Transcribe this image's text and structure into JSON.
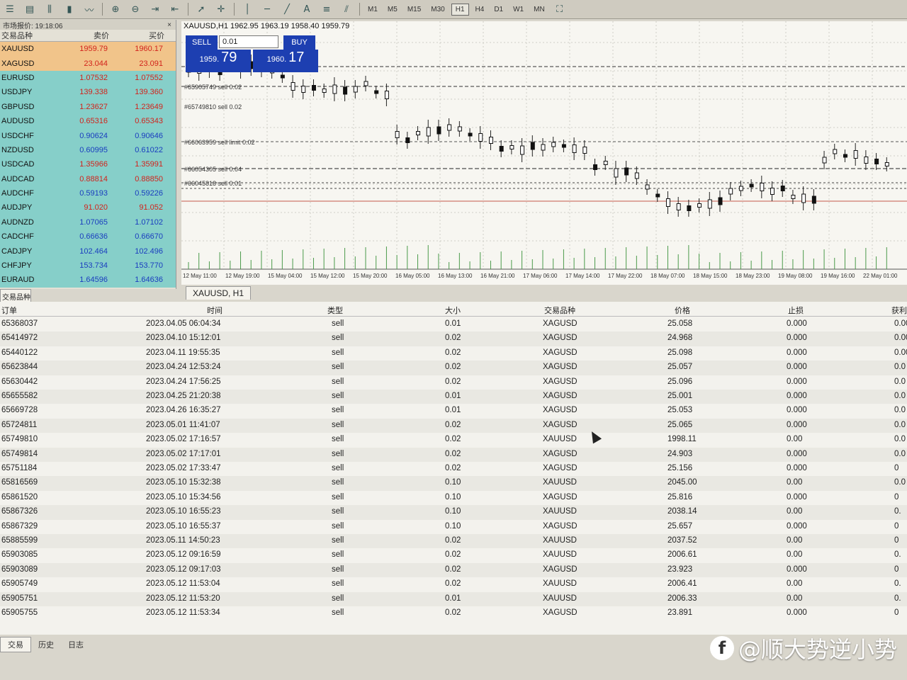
{
  "toolbar": {
    "icons": [
      "menu-icon",
      "profiles-icon",
      "chart-bars-icon",
      "candles-icon",
      "line-chart-icon",
      "zoom-in-icon",
      "zoom-out-icon",
      "autoscroll-icon",
      "chart-shift-icon",
      "cursor-icon",
      "crosshair-icon",
      "vertical-line-icon",
      "horizontal-line-icon",
      "trendline-icon",
      "text-icon",
      "fibonacci-icon",
      "channel-icon"
    ],
    "timeframes": [
      "M1",
      "M5",
      "M15",
      "M30",
      "H1",
      "H4",
      "D1",
      "W1",
      "MN"
    ],
    "active_timeframe": "H1"
  },
  "market_watch": {
    "title": "市场报价: 19:18:06",
    "close_label": "×",
    "col_symbol": "交易品种",
    "col_bid": "卖价",
    "col_ask": "买价",
    "rows": [
      {
        "symbol": "XAUUSD",
        "bid": "1959.79",
        "ask": "1960.17",
        "tone": "warm",
        "bid_color": "red",
        "ask_color": "red"
      },
      {
        "symbol": "XAGUSD",
        "bid": "23.044",
        "ask": "23.091",
        "tone": "warm",
        "bid_color": "red",
        "ask_color": "red"
      },
      {
        "symbol": "EURUSD",
        "bid": "1.07532",
        "ask": "1.07552",
        "tone": "cool",
        "bid_color": "red",
        "ask_color": "red"
      },
      {
        "symbol": "USDJPY",
        "bid": "139.338",
        "ask": "139.360",
        "tone": "cool",
        "bid_color": "red",
        "ask_color": "red"
      },
      {
        "symbol": "GBPUSD",
        "bid": "1.23627",
        "ask": "1.23649",
        "tone": "cool",
        "bid_color": "red",
        "ask_color": "red"
      },
      {
        "symbol": "AUDUSD",
        "bid": "0.65316",
        "ask": "0.65343",
        "tone": "cool",
        "bid_color": "red",
        "ask_color": "red"
      },
      {
        "symbol": "USDCHF",
        "bid": "0.90624",
        "ask": "0.90646",
        "tone": "cool",
        "bid_color": "blue",
        "ask_color": "blue"
      },
      {
        "symbol": "NZDUSD",
        "bid": "0.60995",
        "ask": "0.61022",
        "tone": "cool",
        "bid_color": "blue",
        "ask_color": "blue"
      },
      {
        "symbol": "USDCAD",
        "bid": "1.35966",
        "ask": "1.35991",
        "tone": "cool",
        "bid_color": "red",
        "ask_color": "red"
      },
      {
        "symbol": "AUDCAD",
        "bid": "0.88814",
        "ask": "0.88850",
        "tone": "cool",
        "bid_color": "red",
        "ask_color": "red"
      },
      {
        "symbol": "AUDCHF",
        "bid": "0.59193",
        "ask": "0.59226",
        "tone": "cool",
        "bid_color": "blue",
        "ask_color": "blue"
      },
      {
        "symbol": "AUDJPY",
        "bid": "91.020",
        "ask": "91.052",
        "tone": "cool",
        "bid_color": "red",
        "ask_color": "red"
      },
      {
        "symbol": "AUDNZD",
        "bid": "1.07065",
        "ask": "1.07102",
        "tone": "cool",
        "bid_color": "blue",
        "ask_color": "blue"
      },
      {
        "symbol": "CADCHF",
        "bid": "0.66636",
        "ask": "0.66670",
        "tone": "cool",
        "bid_color": "blue",
        "ask_color": "blue"
      },
      {
        "symbol": "CADJPY",
        "bid": "102.464",
        "ask": "102.496",
        "tone": "cool",
        "bid_color": "blue",
        "ask_color": "blue"
      },
      {
        "symbol": "CHFJPY",
        "bid": "153.734",
        "ask": "153.770",
        "tone": "cool",
        "bid_color": "blue",
        "ask_color": "blue"
      },
      {
        "symbol": "EURAUD",
        "bid": "1.64596",
        "ask": "1.64636",
        "tone": "cool",
        "bid_color": "blue",
        "ask_color": "blue"
      }
    ],
    "tab_label": "交易品种"
  },
  "chart": {
    "info_line": "XAUUSD,H1  1962.95 1963.19 1958.40 1959.79",
    "sell_label": "SELL",
    "buy_label": "BUY",
    "lot_value": "0.01",
    "sell_price_small": "1959.",
    "sell_price_big": "79",
    "buy_price_small": "1960.",
    "buy_price_big": "17",
    "order_labels": [
      {
        "text": "#65905749 sell 0.02"
      },
      {
        "text": "#65749810 sell 0.02"
      },
      {
        "text": "#66063959 sell limit 0.02"
      },
      {
        "text": "#66054305 sell 0.04"
      },
      {
        "text": "#66045818 sell 0.01"
      }
    ],
    "time_labels": [
      "12 May 11:00",
      "12 May 19:00",
      "15 May 04:00",
      "15 May 12:00",
      "15 May 20:00",
      "16 May 05:00",
      "16 May 13:00",
      "16 May 21:00",
      "17 May 06:00",
      "17 May 14:00",
      "17 May 22:00",
      "18 May 07:00",
      "18 May 15:00",
      "18 May 23:00",
      "19 May 08:00",
      "19 May 16:00",
      "22 May 01:00"
    ],
    "tab_label": "XAUUSD, H1"
  },
  "orders": {
    "headers": {
      "order": "订单",
      "time": "时间",
      "type": "类型",
      "size": "大小",
      "symbol": "交易品种",
      "price": "价格",
      "sl": "止损",
      "tp": "获利"
    },
    "rows": [
      {
        "order": "65368037",
        "time": "2023.04.05 06:04:34",
        "type": "sell",
        "size": "0.01",
        "symbol": "XAGUSD",
        "price": "25.058",
        "sl": "0.000",
        "tp": "0.00"
      },
      {
        "order": "65414972",
        "time": "2023.04.10 15:12:01",
        "type": "sell",
        "size": "0.02",
        "symbol": "XAGUSD",
        "price": "24.968",
        "sl": "0.000",
        "tp": "0.00"
      },
      {
        "order": "65440122",
        "time": "2023.04.11 19:55:35",
        "type": "sell",
        "size": "0.02",
        "symbol": "XAGUSD",
        "price": "25.098",
        "sl": "0.000",
        "tp": "0.00"
      },
      {
        "order": "65623844",
        "time": "2023.04.24 12:53:24",
        "type": "sell",
        "size": "0.02",
        "symbol": "XAGUSD",
        "price": "25.057",
        "sl": "0.000",
        "tp": "0.0"
      },
      {
        "order": "65630442",
        "time": "2023.04.24 17:56:25",
        "type": "sell",
        "size": "0.02",
        "symbol": "XAGUSD",
        "price": "25.096",
        "sl": "0.000",
        "tp": "0.0"
      },
      {
        "order": "65655582",
        "time": "2023.04.25 21:20:38",
        "type": "sell",
        "size": "0.01",
        "symbol": "XAGUSD",
        "price": "25.001",
        "sl": "0.000",
        "tp": "0.0"
      },
      {
        "order": "65669728",
        "time": "2023.04.26 16:35:27",
        "type": "sell",
        "size": "0.01",
        "symbol": "XAGUSD",
        "price": "25.053",
        "sl": "0.000",
        "tp": "0.0"
      },
      {
        "order": "65724811",
        "time": "2023.05.01 11:41:07",
        "type": "sell",
        "size": "0.02",
        "symbol": "XAGUSD",
        "price": "25.065",
        "sl": "0.000",
        "tp": "0.0"
      },
      {
        "order": "65749810",
        "time": "2023.05.02 17:16:57",
        "type": "sell",
        "size": "0.02",
        "symbol": "XAUUSD",
        "price": "1998.11",
        "sl": "0.00",
        "tp": "0.0"
      },
      {
        "order": "65749814",
        "time": "2023.05.02 17:17:01",
        "type": "sell",
        "size": "0.02",
        "symbol": "XAGUSD",
        "price": "24.903",
        "sl": "0.000",
        "tp": "0.0"
      },
      {
        "order": "65751184",
        "time": "2023.05.02 17:33:47",
        "type": "sell",
        "size": "0.02",
        "symbol": "XAGUSD",
        "price": "25.156",
        "sl": "0.000",
        "tp": "0"
      },
      {
        "order": "65816569",
        "time": "2023.05.10 15:32:38",
        "type": "sell",
        "size": "0.10",
        "symbol": "XAUUSD",
        "price": "2045.00",
        "sl": "0.00",
        "tp": "0.0"
      },
      {
        "order": "65861520",
        "time": "2023.05.10 15:34:56",
        "type": "sell",
        "size": "0.10",
        "symbol": "XAGUSD",
        "price": "25.816",
        "sl": "0.000",
        "tp": "0"
      },
      {
        "order": "65867326",
        "time": "2023.05.10 16:55:23",
        "type": "sell",
        "size": "0.10",
        "symbol": "XAUUSD",
        "price": "2038.14",
        "sl": "0.00",
        "tp": "0."
      },
      {
        "order": "65867329",
        "time": "2023.05.10 16:55:37",
        "type": "sell",
        "size": "0.10",
        "symbol": "XAGUSD",
        "price": "25.657",
        "sl": "0.000",
        "tp": "0"
      },
      {
        "order": "65885599",
        "time": "2023.05.11 14:50:23",
        "type": "sell",
        "size": "0.02",
        "symbol": "XAUUSD",
        "price": "2037.52",
        "sl": "0.00",
        "tp": "0"
      },
      {
        "order": "65903085",
        "time": "2023.05.12 09:16:59",
        "type": "sell",
        "size": "0.02",
        "symbol": "XAUUSD",
        "price": "2006.61",
        "sl": "0.00",
        "tp": "0."
      },
      {
        "order": "65903089",
        "time": "2023.05.12 09:17:03",
        "type": "sell",
        "size": "0.02",
        "symbol": "XAGUSD",
        "price": "23.923",
        "sl": "0.000",
        "tp": "0"
      },
      {
        "order": "65905749",
        "time": "2023.05.12 11:53:04",
        "type": "sell",
        "size": "0.02",
        "symbol": "XAUUSD",
        "price": "2006.41",
        "sl": "0.00",
        "tp": "0."
      },
      {
        "order": "65905751",
        "time": "2023.05.12 11:53:20",
        "type": "sell",
        "size": "0.01",
        "symbol": "XAUUSD",
        "price": "2006.33",
        "sl": "0.00",
        "tp": "0."
      },
      {
        "order": "65905755",
        "time": "2023.05.12 11:53:34",
        "type": "sell",
        "size": "0.02",
        "symbol": "XAGUSD",
        "price": "23.891",
        "sl": "0.000",
        "tp": "0"
      }
    ]
  },
  "bottom_tabs": [
    "交易",
    "历史",
    "日志"
  ],
  "watermark": "@顺大势逆小势"
}
